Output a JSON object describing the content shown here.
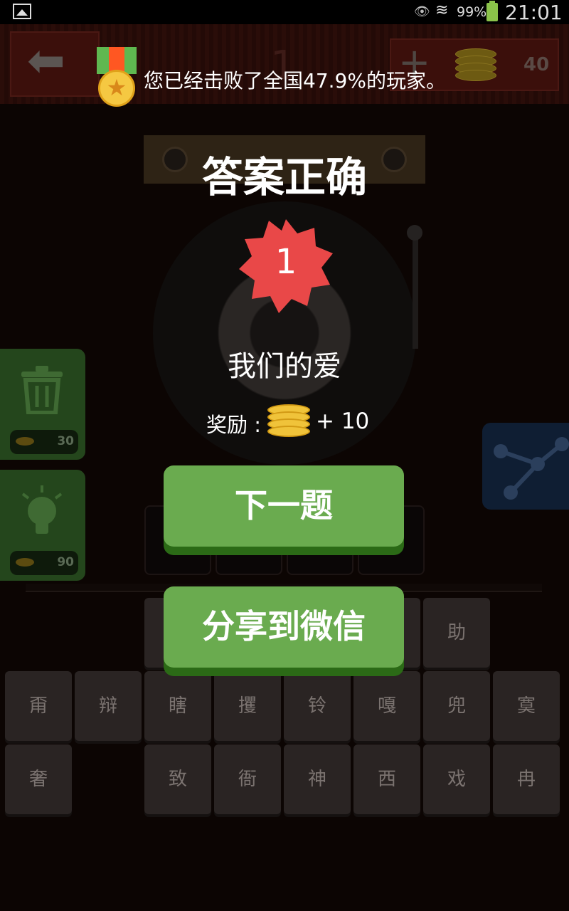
{
  "status_bar": {
    "battery_pct": "99%",
    "time": "21:01"
  },
  "header": {
    "level_ghost": "1",
    "coins": "40"
  },
  "congrats": {
    "message": "您已经击败了全国47.9%的玩家。"
  },
  "dialog": {
    "title": "答案正确",
    "level_number": "1",
    "song_name": "我们的爱",
    "reward_label": "奖励 :",
    "reward_amount": "+ 10",
    "next_button": "下一题",
    "share_button": "分享到微信"
  },
  "side_tools": {
    "delete_cost": "30",
    "hint_cost": "90"
  },
  "keyboard": {
    "row1": [
      "",
      "",
      "",
      "",
      "助"
    ],
    "row2": [
      "甭",
      "辩",
      "瞎",
      "攫",
      "铃",
      "嘎",
      "兜",
      "寞"
    ],
    "row3": [
      "奢",
      "",
      "致",
      "衙",
      "神",
      "西",
      "戏",
      "冉"
    ]
  },
  "colors": {
    "button_green": "#6aab4f",
    "button_shadow": "#2b6a16",
    "badge_red": "#e94848",
    "coin_gold": "#f0c33a"
  }
}
